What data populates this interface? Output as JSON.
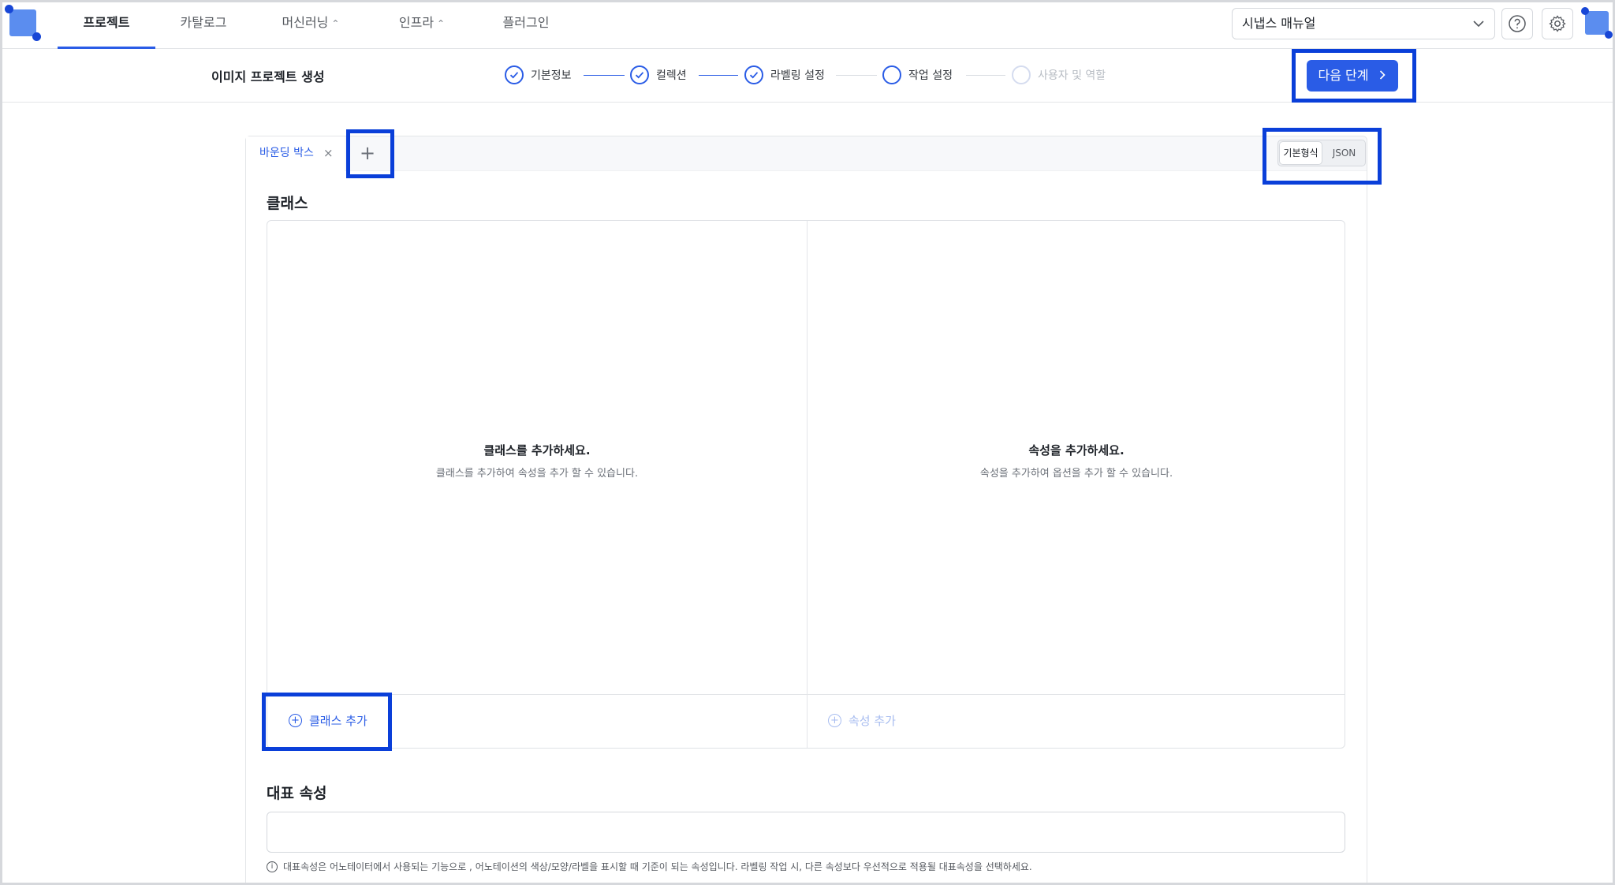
{
  "nav": {
    "items": [
      {
        "label": "프로젝트",
        "active": true,
        "has_chevron": false
      },
      {
        "label": "카탈로그",
        "active": false,
        "has_chevron": false
      },
      {
        "label": "머신러닝",
        "active": false,
        "has_chevron": true
      },
      {
        "label": "인프라",
        "active": false,
        "has_chevron": true
      },
      {
        "label": "플러그인",
        "active": false,
        "has_chevron": false
      }
    ],
    "chevron_glyph": "⌃⌄",
    "workspace_select": "시냅스 매뉴얼",
    "help_icon": "question-circle-icon",
    "settings_icon": "gear-icon"
  },
  "stepbar": {
    "title": "이미지 프로젝트 생성",
    "steps": [
      {
        "label": "기본정보",
        "state": "done"
      },
      {
        "label": "컬렉션",
        "state": "done"
      },
      {
        "label": "라벨링 설정",
        "state": "done"
      },
      {
        "label": "작업 설정",
        "state": "current"
      },
      {
        "label": "사용자 및 역할",
        "state": "disabled"
      }
    ],
    "next_button": "다음 단계"
  },
  "editor": {
    "tab_label": "바운딩 박스",
    "close_glyph": "×",
    "add_glyph": "+",
    "format_options": [
      "기본형식",
      "JSON"
    ],
    "format_selected": "기본형식",
    "class_section_title": "클래스",
    "class_empty_title": "클래스를 추가하세요.",
    "class_empty_desc": "클래스를 추가하여 속성을 추가 할 수 있습니다.",
    "attr_empty_title": "속성을 추가하세요.",
    "attr_empty_desc": "속성을 추가하여 옵션을 추가 할 수 있습니다.",
    "add_class_label": "클래스 추가",
    "add_attr_label": "속성 추가",
    "rep_section_title": "대표 속성",
    "rep_input_value": "",
    "rep_hint": "대표속성은 어노테이터에서 사용되는 기능으로 , 어노테이션의 색상/모양/라벨을 표시할 때 기준이 되는 속성입니다. 라벨링 작업 시, 다른 속성보다 우선적으로 적용될 대표속성을 선택하세요."
  },
  "colors": {
    "accent": "#2a5ce6",
    "highlight": "#0a3fd9",
    "brand": "#5b8def"
  }
}
